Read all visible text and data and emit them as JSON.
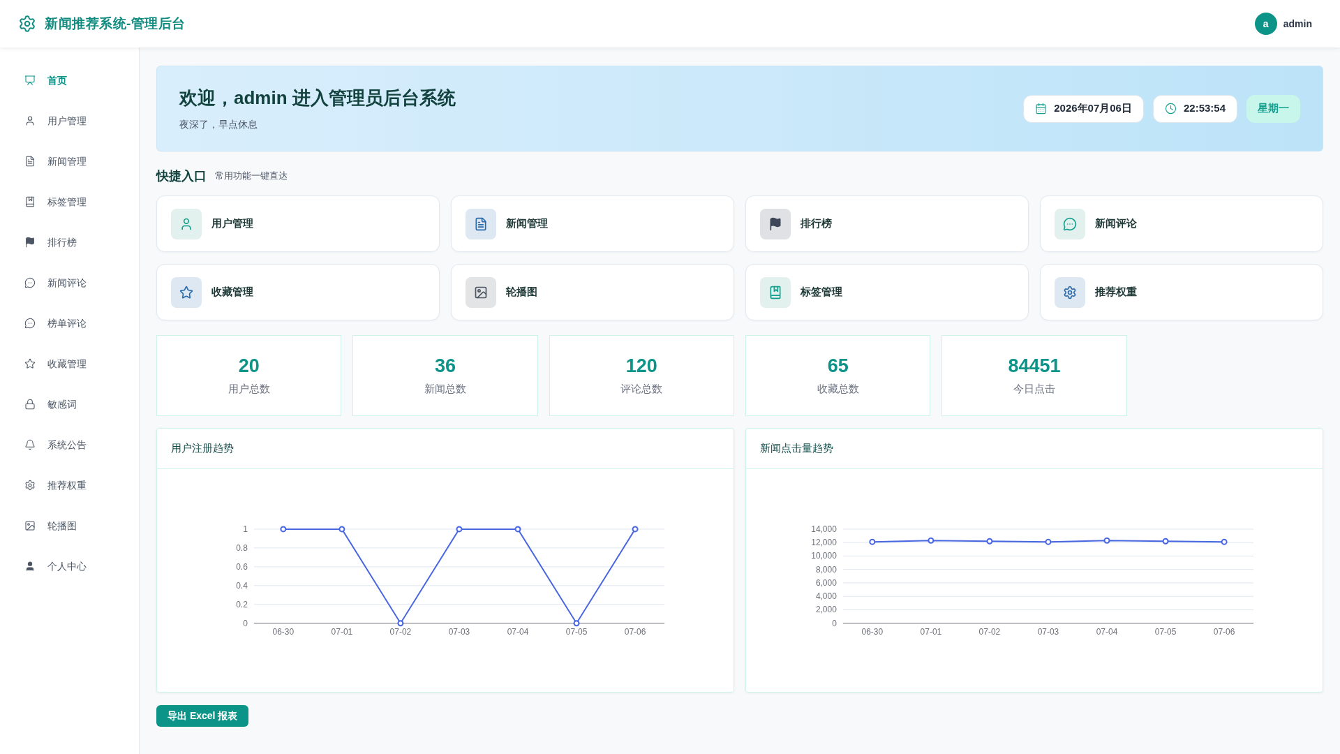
{
  "header": {
    "title": "新闻推荐系统-管理后台",
    "user": {
      "avatar_letter": "a",
      "name": "admin"
    }
  },
  "sidebar": {
    "items": [
      {
        "label": "首页",
        "kind": "dashboard",
        "selected": true
      },
      {
        "label": "用户管理",
        "kind": "user",
        "selected": false
      },
      {
        "label": "新闻管理",
        "kind": "document",
        "selected": false
      },
      {
        "label": "标签管理",
        "kind": "book",
        "selected": false
      },
      {
        "label": "排行榜",
        "kind": "flag",
        "selected": false
      },
      {
        "label": "新闻评论",
        "kind": "comment",
        "selected": false
      },
      {
        "label": "榜单评论",
        "kind": "comment",
        "selected": false
      },
      {
        "label": "收藏管理",
        "kind": "star",
        "selected": false
      },
      {
        "label": "敏感词",
        "kind": "lock",
        "selected": false
      },
      {
        "label": "系统公告",
        "kind": "bell",
        "selected": false
      },
      {
        "label": "推荐权重",
        "kind": "gear",
        "selected": false
      },
      {
        "label": "轮播图",
        "kind": "image",
        "selected": false
      },
      {
        "label": "个人中心",
        "kind": "person",
        "selected": false
      }
    ]
  },
  "welcome": {
    "title": "欢迎，admin 进入管理员后台系统",
    "subtitle": "夜深了，早点休息",
    "date": "2026年07月06日",
    "time": "22:53:54",
    "weekday": "星期一"
  },
  "quick_entry": {
    "title": "快捷入口",
    "subtitle": "常用功能一键直达",
    "items": [
      {
        "label": "用户管理",
        "kind": "user",
        "color": "#14a08f"
      },
      {
        "label": "新闻管理",
        "kind": "document",
        "color": "#2a6aa8"
      },
      {
        "label": "排行榜",
        "kind": "flag",
        "color": "#3d4757"
      },
      {
        "label": "新闻评论",
        "kind": "comment",
        "color": "#14a08f"
      },
      {
        "label": "收藏管理",
        "kind": "star",
        "color": "#2a6aa8"
      },
      {
        "label": "轮播图",
        "kind": "image",
        "color": "#4b5563"
      },
      {
        "label": "标签管理",
        "kind": "book",
        "color": "#14a08f"
      },
      {
        "label": "推荐权重",
        "kind": "gear",
        "color": "#2a6aa8"
      }
    ]
  },
  "stats": [
    {
      "value": "20",
      "label": "用户总数"
    },
    {
      "value": "36",
      "label": "新闻总数"
    },
    {
      "value": "120",
      "label": "评论总数"
    },
    {
      "value": "65",
      "label": "收藏总数"
    },
    {
      "value": "84451",
      "label": "今日点击"
    }
  ],
  "charts": [
    {
      "title": "用户注册趋势",
      "chart_data": {
        "type": "line",
        "categories": [
          "06-30",
          "07-01",
          "07-02",
          "07-03",
          "07-04",
          "07-05",
          "07-06"
        ],
        "series": [
          {
            "color": "#4766e0",
            "marker": "circle",
            "values": [
              1,
              1,
              0,
              1,
              1,
              0,
              1
            ]
          }
        ],
        "ylim": [
          0,
          1
        ],
        "yticks": [
          0,
          0.2,
          0.4,
          0.6,
          0.8,
          1
        ],
        "grid": true
      }
    },
    {
      "title": "新闻点击量趋势",
      "chart_data": {
        "type": "line",
        "categories": [
          "06-30",
          "07-01",
          "07-02",
          "07-03",
          "07-04",
          "07-05",
          "07-06"
        ],
        "series": [
          {
            "color": "#4766e0",
            "marker": "circle",
            "values": [
              12100,
              12300,
              12200,
              12100,
              12300,
              12200,
              12100
            ]
          }
        ],
        "ylim": [
          0,
          14000
        ],
        "yticks": [
          {
            "value": 0,
            "label": "0"
          },
          {
            "value": 2000,
            "label": "2,000"
          },
          {
            "value": 4000,
            "label": "4,000"
          },
          {
            "value": 6000,
            "label": "6,000"
          },
          {
            "value": 8000,
            "label": "8,000"
          },
          {
            "value": 10000,
            "label": "10,000"
          },
          {
            "value": 12000,
            "label": "12,000"
          },
          {
            "value": 14000,
            "label": "14,000"
          }
        ],
        "grid": true
      }
    }
  ],
  "export_button": "导出 Excel 报表"
}
